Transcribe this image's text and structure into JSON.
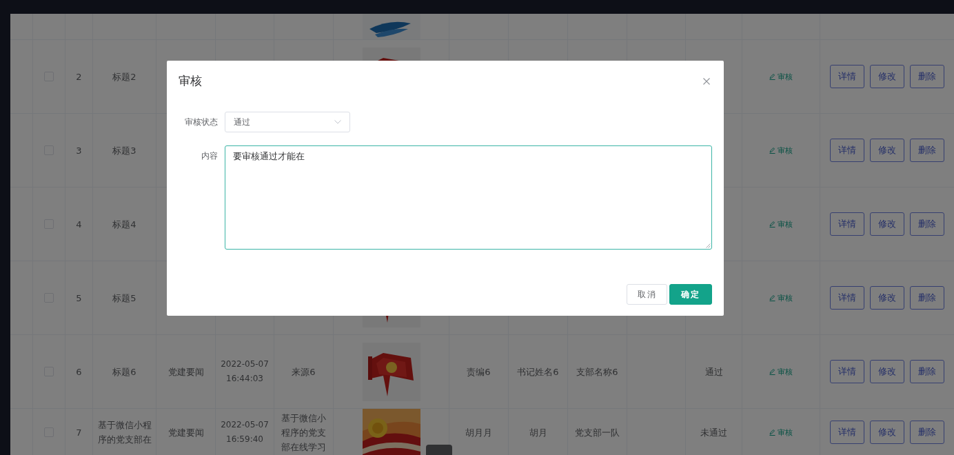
{
  "table": {
    "rows": [
      {
        "image": {
          "kind": "picture"
        }
      },
      {
        "checked": false,
        "index": "2",
        "title": "标题2",
        "image": {
          "kind": "picture"
        },
        "audit_link": "审核",
        "actions": [
          "详情",
          "修改",
          "删除"
        ]
      },
      {
        "checked": false,
        "index": "3",
        "title": "标题3",
        "audit_link": "审核",
        "actions": [
          "详情",
          "修改",
          "删除"
        ]
      },
      {
        "checked": false,
        "index": "4",
        "title": "标题4",
        "audit_link": "审核",
        "actions": [
          "详情",
          "修改",
          "删除"
        ]
      },
      {
        "checked": false,
        "index": "5",
        "title": "标题5",
        "image": {
          "kind": "picture"
        },
        "audit_link": "审核",
        "actions": [
          "详情",
          "修改",
          "删除"
        ]
      },
      {
        "checked": false,
        "index": "6",
        "title": "标题6",
        "type": "党建要闻",
        "date": "2022-05-07 16:44:03",
        "source": "来源6",
        "image": {
          "kind": "picture"
        },
        "editor": "责编6",
        "secretary": "书记姓名6",
        "branch": "支部名称6",
        "status": "通过",
        "audit_link": "审核",
        "actions": [
          "详情",
          "修改",
          "删除"
        ]
      },
      {
        "checked": false,
        "index": "7",
        "title": "基于微信小程序的党支部在",
        "type": "党建要闻",
        "date": "2022-05-07 16:59:40",
        "source": "基于微信小程序的党支部在线学习",
        "image": {
          "kind": "picture"
        },
        "editor": "胡月月",
        "secretary": "胡月",
        "branch": "党支部一队",
        "status": "未通过",
        "audit_link": "审核",
        "actions": [
          "详情",
          "修改",
          "删除"
        ]
      }
    ]
  },
  "modal": {
    "title": "审核",
    "fields": [
      {
        "kind": "select",
        "label": "审核状态",
        "value": "通过"
      },
      {
        "kind": "textarea",
        "label": "内容",
        "value": "要审核通过才能在"
      }
    ],
    "buttons": [
      {
        "kind": "default",
        "label": "取消"
      },
      {
        "kind": "primary",
        "label": "确定"
      }
    ]
  }
}
